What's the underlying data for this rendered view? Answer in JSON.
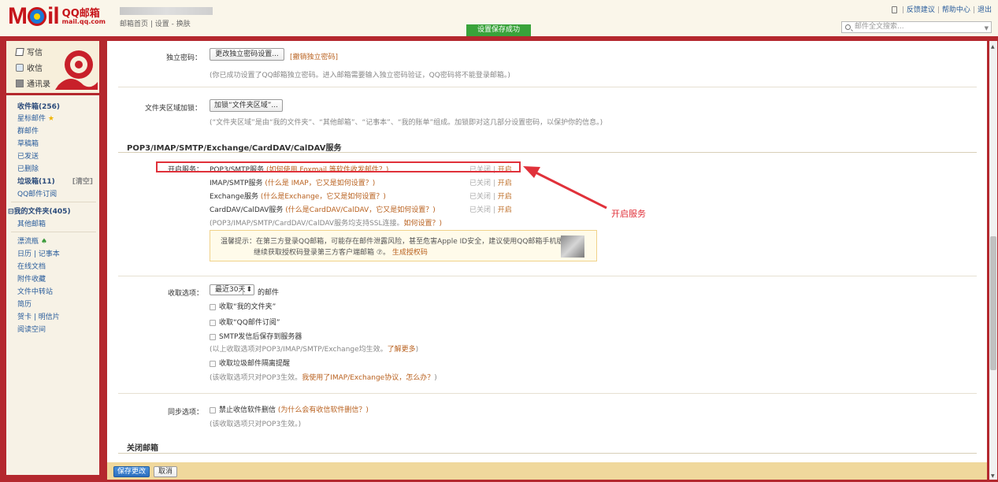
{
  "header": {
    "logo_mail": "Mail",
    "logo_qq": "QQ邮箱",
    "logo_sub": "mail.qq.com",
    "top_links": "邮箱首页 | 设置 - 换肤",
    "saved_banner": "设置保存成功",
    "right_links": [
      "反馈建议",
      "帮助中心",
      "退出"
    ],
    "search_placeholder": "邮件全文搜索..."
  },
  "sidebar": {
    "actions": [
      "写信",
      "收信",
      "通讯录"
    ],
    "items": [
      {
        "label": "收件箱(256)",
        "bold": true
      },
      {
        "label": "星标邮件",
        "star": true
      },
      {
        "label": "群邮件"
      },
      {
        "label": "草稿箱"
      },
      {
        "label": "已发送"
      },
      {
        "label": "已删除"
      },
      {
        "label": "垃圾箱(11)",
        "bold": true,
        "extra": "[清空]"
      },
      {
        "label": "QQ邮件订阅"
      },
      {
        "label": "我的文件夹(405)",
        "bold": true,
        "prefix": "⊟"
      },
      {
        "label": "其他邮箱"
      },
      {
        "label": "漂流瓶",
        "bottle": true
      },
      {
        "label": "日历 | 记事本"
      },
      {
        "label": "在线文档"
      },
      {
        "label": "附件收藏"
      },
      {
        "label": "文件中转站"
      },
      {
        "label": "简历"
      },
      {
        "label": "贺卡 | 明信片"
      },
      {
        "label": "阅读空间"
      }
    ]
  },
  "settings": {
    "pwd_label": "独立密码：",
    "pwd_button": "更改独立密码设置...",
    "pwd_cancel": "[撤销独立密码]",
    "pwd_hint": "(你已成功设置了QQ邮箱独立密码。进入邮箱需要输入独立密码验证，QQ密码将不能登录邮箱。)",
    "folder_label": "文件夹区域加锁：",
    "folder_button": "加锁“文件夹区域”...",
    "folder_hint": "(“文件夹区域”是由“我的文件夹”、“其他邮箱”、“记事本”、“我的账单”组成。加锁即对这几部分设置密码，以保护你的信息。)",
    "section_title": "POP3/IMAP/SMTP/Exchange/CardDAV/CalDAV服务",
    "service_label": "开启服务：",
    "services": [
      {
        "name": "POP3/SMTP服务",
        "help": "(如何使用 Foxmail 等软件收发邮件？)",
        "status": "已关闭",
        "action": "开启"
      },
      {
        "name": "IMAP/SMTP服务",
        "help": "(什么是 IMAP，它又是如何设置？)",
        "status": "已关闭",
        "action": "开启"
      },
      {
        "name": "Exchange服务",
        "help": "(什么是Exchange，它又是如何设置？)",
        "status": "已关闭",
        "action": "开启"
      },
      {
        "name": "CardDAV/CalDAV服务",
        "help": "(什么是CardDAV/CalDAV，它又是如何设置？)",
        "status": "已关闭",
        "action": "开启"
      }
    ],
    "ssl_hint": "(POP3/IMAP/SMTP/CardDAV/CalDAV服务均支持SSL连接。",
    "ssl_link": "如何设置？)",
    "tip_line1": "温馨提示：在第三方登录QQ邮箱，可能存在邮件泄露风险，甚至危害Apple ID安全，建议使用QQ邮箱手机版登录。",
    "tip_line2_a": "继续获取授权码登录第三方客户端邮箱",
    "tip_help": "⑦",
    "tip_link": "生成授权码",
    "annotation": "开启服务",
    "receive_label": "收取选项：",
    "receive_select": "最近30天",
    "receive_suffix": "的邮件",
    "receive_options": [
      "收取“我的文件夹”",
      "收取“QQ邮件订阅”",
      "SMTP发信后保存到服务器"
    ],
    "receive_hint": "(以上收取选项对POP3/IMAP/SMTP/Exchange均生效。",
    "receive_hint_link": "了解更多",
    "receive_hint_end": ")",
    "junk_option": "收取垃圾邮件隔离提醒",
    "junk_hint": "(该收取选项只对POP3生效。",
    "junk_hint_link": "我使用了IMAP/Exchange协议，怎么办？",
    "junk_hint_end": ")",
    "sync_label": "同步选项：",
    "sync_option": "禁止收信软件删信",
    "sync_help": "(为什么会有收信软件删信？)",
    "sync_hint": "(该收取选项只对POP3生效。)",
    "close_title": "关闭邮箱"
  },
  "footer": {
    "save": "保存更改",
    "cancel": "取消"
  }
}
